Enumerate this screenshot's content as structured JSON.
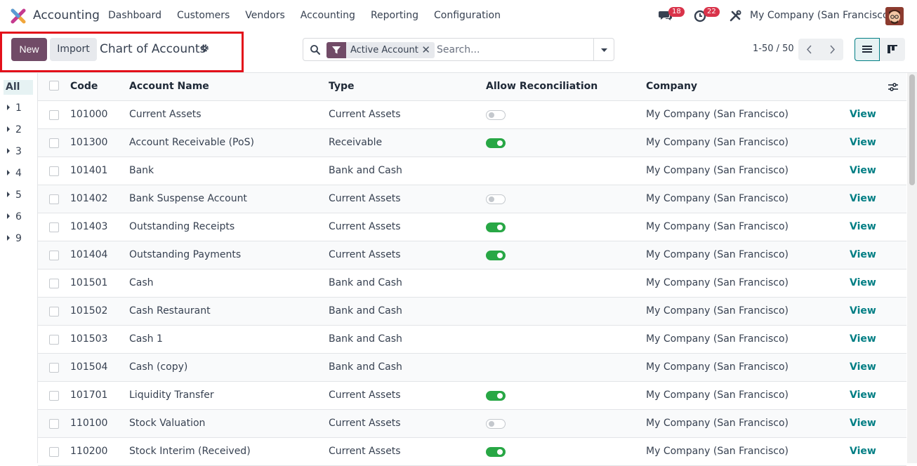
{
  "navbar": {
    "app_name": "Accounting",
    "menu": [
      "Dashboard",
      "Customers",
      "Vendors",
      "Accounting",
      "Reporting",
      "Configuration"
    ],
    "messages_count": "18",
    "activities_count": "22",
    "company": "My Company (San Francisco)"
  },
  "control_panel": {
    "new_label": "New",
    "import_label": "Import",
    "title": "Chart of Accounts",
    "facet_label": "Active Account",
    "search_placeholder": "Search...",
    "pager_value": "1-50 / 50"
  },
  "sidepanel": {
    "all_label": "All",
    "groups": [
      "1",
      "2",
      "3",
      "4",
      "5",
      "6",
      "9"
    ]
  },
  "table": {
    "headers": [
      "Code",
      "Account Name",
      "Type",
      "Allow Reconciliation",
      "Company"
    ],
    "view_label": "View",
    "rows": [
      {
        "code": "101000",
        "name": "Current Assets",
        "type": "Current Assets",
        "reconcile": "off",
        "company": "My Company (San Francisco)"
      },
      {
        "code": "101300",
        "name": "Account Receivable (PoS)",
        "type": "Receivable",
        "reconcile": "on",
        "company": "My Company (San Francisco)"
      },
      {
        "code": "101401",
        "name": "Bank",
        "type": "Bank and Cash",
        "reconcile": "none",
        "company": "My Company (San Francisco)"
      },
      {
        "code": "101402",
        "name": "Bank Suspense Account",
        "type": "Current Assets",
        "reconcile": "off",
        "company": "My Company (San Francisco)"
      },
      {
        "code": "101403",
        "name": "Outstanding Receipts",
        "type": "Current Assets",
        "reconcile": "on",
        "company": "My Company (San Francisco)"
      },
      {
        "code": "101404",
        "name": "Outstanding Payments",
        "type": "Current Assets",
        "reconcile": "on",
        "company": "My Company (San Francisco)"
      },
      {
        "code": "101501",
        "name": "Cash",
        "type": "Bank and Cash",
        "reconcile": "none",
        "company": "My Company (San Francisco)"
      },
      {
        "code": "101502",
        "name": "Cash Restaurant",
        "type": "Bank and Cash",
        "reconcile": "none",
        "company": "My Company (San Francisco)"
      },
      {
        "code": "101503",
        "name": "Cash 1",
        "type": "Bank and Cash",
        "reconcile": "none",
        "company": "My Company (San Francisco)"
      },
      {
        "code": "101504",
        "name": "Cash (copy)",
        "type": "Bank and Cash",
        "reconcile": "none",
        "company": "My Company (San Francisco)"
      },
      {
        "code": "101701",
        "name": "Liquidity Transfer",
        "type": "Current Assets",
        "reconcile": "on",
        "company": "My Company (San Francisco)"
      },
      {
        "code": "110100",
        "name": "Stock Valuation",
        "type": "Current Assets",
        "reconcile": "off",
        "company": "My Company (San Francisco)"
      },
      {
        "code": "110200",
        "name": "Stock Interim (Received)",
        "type": "Current Assets",
        "reconcile": "on",
        "company": "My Company (San Francisco)"
      }
    ]
  },
  "colors": {
    "brand": "#714b67",
    "link": "#017e84",
    "toggle_on": "#28a745",
    "highlight": "#e3101a"
  }
}
